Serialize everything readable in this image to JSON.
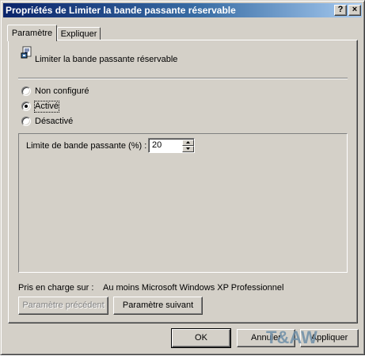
{
  "window": {
    "title": "Propriétés de Limiter la bande passante réservable",
    "help_button": "?",
    "close_button": "×"
  },
  "tabs": [
    {
      "label": "Paramètre",
      "active": true
    },
    {
      "label": "Expliquer",
      "active": false
    }
  ],
  "policy": {
    "icon": "policy-setting-icon",
    "name": "Limiter la bande passante réservable"
  },
  "state_options": [
    {
      "label": "Non configuré",
      "selected": false
    },
    {
      "label": "Activé",
      "selected": true
    },
    {
      "label": "Désactivé",
      "selected": false
    }
  ],
  "options": {
    "bandwidth_label": "Limite de bande passante (%) :",
    "bandwidth_value": "20"
  },
  "supported": {
    "label": "Pris en charge sur :",
    "value": "Au moins Microsoft Windows XP Professionnel"
  },
  "nav_buttons": {
    "previous": "Paramètre précédent",
    "next": "Paramètre suivant"
  },
  "dialog_buttons": {
    "ok": "OK",
    "cancel": "Annuler",
    "apply": "Appliquer"
  },
  "watermark": "T&AW",
  "colors": {
    "face": "#d4d0c8",
    "title_gradient_start": "#0a246a",
    "title_gradient_end": "#a6caf0"
  }
}
